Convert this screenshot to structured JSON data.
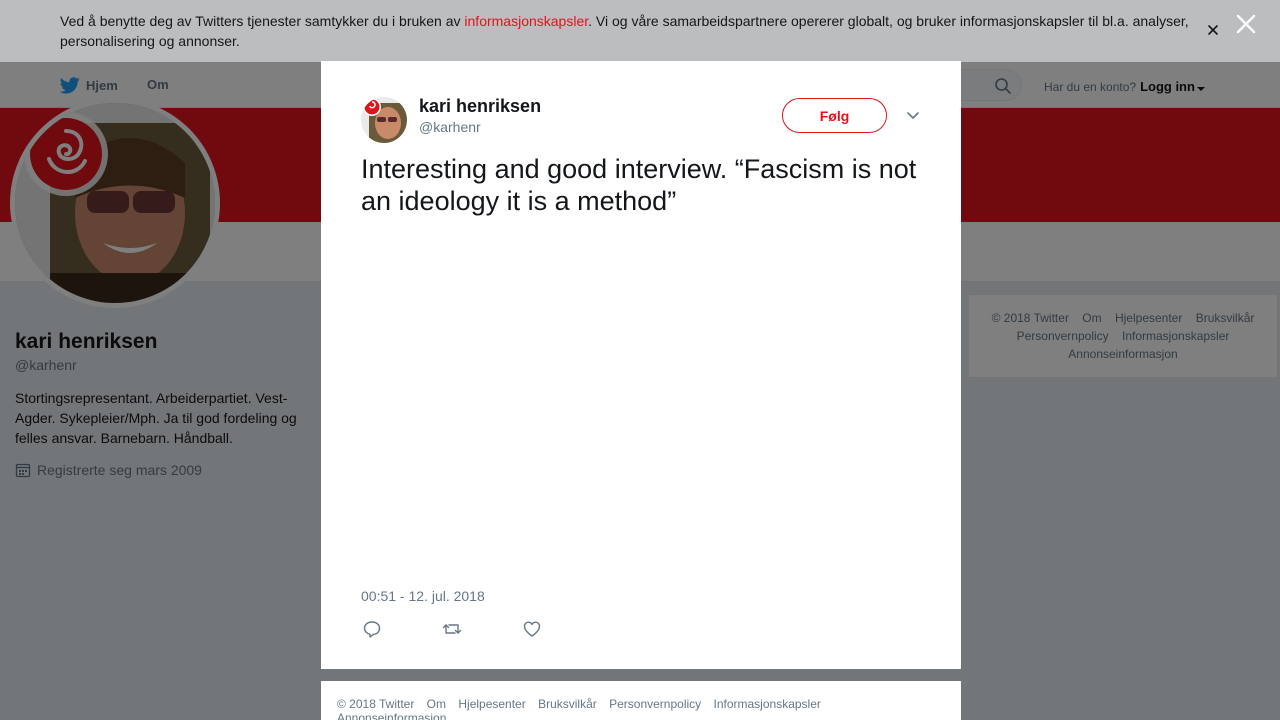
{
  "nav": {
    "home_label": "Hjem",
    "about_label": "Om",
    "login_prompt": "Har du en konto?",
    "login_label": "Logg inn"
  },
  "profile": {
    "name": "kari henriksen",
    "handle": "@karhenr",
    "bio": "Stortingsrepresentant. Arbeiderpartiet. Vest-Agder. Sykepleier/Mph. Ja til god fordeling og felles ansvar. Barnebarn. Håndball.",
    "joined": "Registrerte seg mars 2009"
  },
  "side_footer": {
    "items": [
      "© 2018 Twitter",
      "Om",
      "Hjelpesenter",
      "Bruksvilkår",
      "Personvernpolicy",
      "Informasjonskapsler",
      "Annonseinformasjon"
    ]
  },
  "cookie": {
    "text_before": "Ved å benytte deg av Twitters tjenester samtykker du i bruken av ",
    "link": "informasjonskapsler",
    "text_after": ". Vi og våre samarbeidspartnere opererer globalt, og bruker informasjonskapsler til bl.a. analyser, personalisering og annonser."
  },
  "tweet": {
    "name": "kari henriksen",
    "handle": "@karhenr",
    "follow_label": "Følg",
    "text": "Interesting and good interview.  “Fascism is not an ideology it is a method”",
    "timestamp": "00:51 - 12. jul. 2018"
  },
  "modal_footer": {
    "items": [
      "© 2018 Twitter",
      "Om",
      "Hjelpesenter",
      "Bruksvilkår",
      "Personvernpolicy",
      "Informasjonskapsler",
      "Annonseinformasjon"
    ]
  },
  "colors": {
    "brand_red": "#e0141c",
    "twitter_blue": "#1da1f2"
  }
}
